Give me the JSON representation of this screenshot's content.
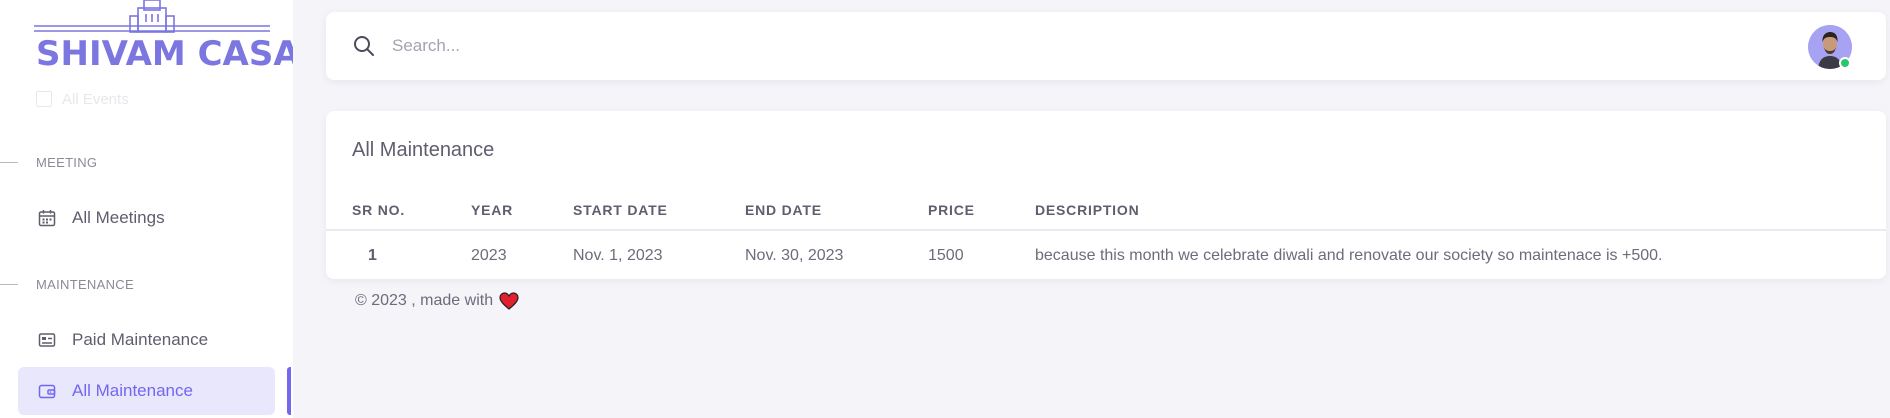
{
  "brand": {
    "name": "SHIVAM CASA"
  },
  "sidebar": {
    "faded_item": "All Events",
    "sections": [
      {
        "header": "MEETING",
        "items": [
          {
            "label": "All Meetings",
            "icon": "calendar-icon"
          }
        ]
      },
      {
        "header": "MAINTENANCE",
        "items": [
          {
            "label": "Paid Maintenance",
            "icon": "id-card-icon"
          },
          {
            "label": "All Maintenance",
            "icon": "wallet-icon",
            "active": true
          }
        ]
      }
    ]
  },
  "search": {
    "placeholder": "Search..."
  },
  "user": {
    "status": "online"
  },
  "card": {
    "title": "All Maintenance",
    "columns": [
      "SR NO.",
      "YEAR",
      "START DATE",
      "END DATE",
      "PRICE",
      "DESCRIPTION"
    ],
    "rows": [
      [
        "1",
        "2023",
        "Nov. 1, 2023",
        "Nov. 30, 2023",
        "1500",
        "because this month we celebrate diwali and renovate our society so maintenace is +500."
      ]
    ]
  },
  "footer": {
    "text": "© 2023 , made with"
  },
  "colors": {
    "accent": "#7367f0",
    "brand": "#7b76e0",
    "online": "#28c76f",
    "heart": "#e0202f"
  }
}
